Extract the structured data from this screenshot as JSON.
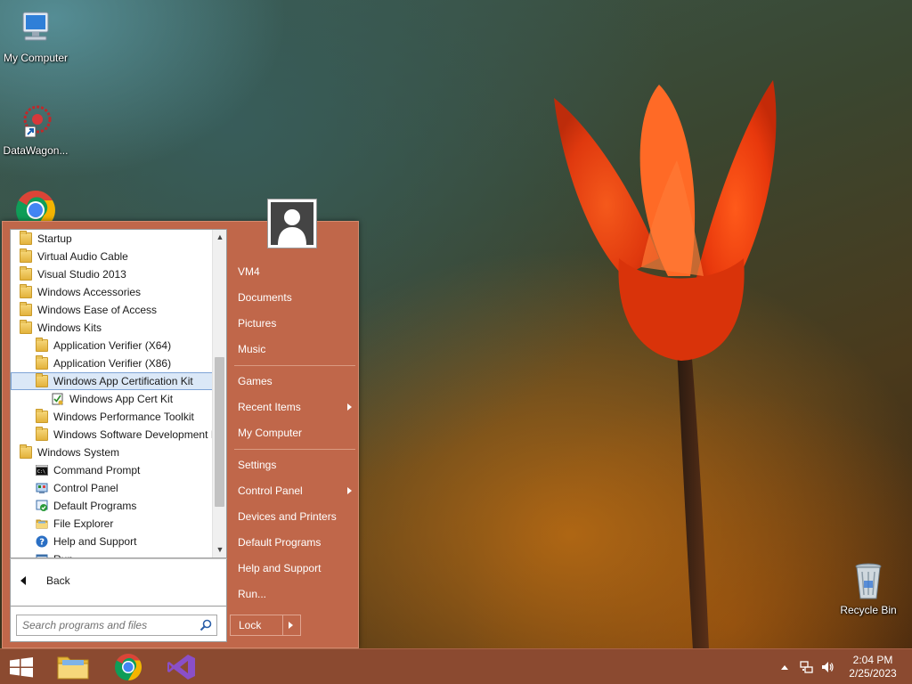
{
  "desktop": {
    "icons": [
      {
        "label": "My Computer"
      },
      {
        "label": "DataWagon..."
      },
      {
        "label": "Recycle Bin"
      }
    ]
  },
  "start_menu": {
    "programs": [
      {
        "label": "Startup",
        "icon": "folder-icon",
        "level": 0
      },
      {
        "label": "Virtual Audio Cable",
        "icon": "folder-icon",
        "level": 0
      },
      {
        "label": "Visual Studio 2013",
        "icon": "folder-icon",
        "level": 0
      },
      {
        "label": "Windows Accessories",
        "icon": "folder-icon",
        "level": 0
      },
      {
        "label": "Windows Ease of Access",
        "icon": "folder-icon",
        "level": 0
      },
      {
        "label": "Windows Kits",
        "icon": "folder-icon",
        "level": 0
      },
      {
        "label": "Application Verifier (X64)",
        "icon": "folder-icon",
        "level": 1
      },
      {
        "label": "Application Verifier (X86)",
        "icon": "folder-icon",
        "level": 1
      },
      {
        "label": "Windows App Certification Kit",
        "icon": "folder-icon",
        "level": 1,
        "selected": true
      },
      {
        "label": "Windows App Cert Kit",
        "icon": "cert-kit-icon",
        "level": 2
      },
      {
        "label": "Windows Performance Toolkit",
        "icon": "folder-icon",
        "level": 1
      },
      {
        "label": "Windows Software Development I",
        "icon": "folder-icon",
        "level": 1
      },
      {
        "label": "Windows System",
        "icon": "folder-icon",
        "level": 0
      },
      {
        "label": "Command Prompt",
        "icon": "command-prompt-icon",
        "level": 1
      },
      {
        "label": "Control Panel",
        "icon": "control-panel-icon",
        "level": 1
      },
      {
        "label": "Default Programs",
        "icon": "default-programs-icon",
        "level": 1
      },
      {
        "label": "File Explorer",
        "icon": "file-explorer-icon",
        "level": 1
      },
      {
        "label": "Help and Support",
        "icon": "help-icon",
        "level": 1
      },
      {
        "label": "Run",
        "icon": "run-icon",
        "level": 1
      }
    ],
    "back_label": "Back",
    "search_placeholder": "Search programs and files",
    "right_items": [
      {
        "label": "VM4",
        "submenu": false
      },
      {
        "label": "Documents",
        "submenu": false
      },
      {
        "label": "Pictures",
        "submenu": false
      },
      {
        "label": "Music",
        "submenu": false
      },
      {
        "label": "Games",
        "submenu": false
      },
      {
        "label": "Recent Items",
        "submenu": true
      },
      {
        "label": "My Computer",
        "submenu": false
      },
      {
        "label": "Settings",
        "submenu": false
      },
      {
        "label": "Control Panel",
        "submenu": true
      },
      {
        "label": "Devices and Printers",
        "submenu": false
      },
      {
        "label": "Default Programs",
        "submenu": false
      },
      {
        "label": "Help and Support",
        "submenu": false
      },
      {
        "label": "Run...",
        "submenu": false
      }
    ],
    "lock_label": "Lock"
  },
  "taskbar": {
    "pinned": [
      "start-button",
      "file-explorer",
      "google-chrome",
      "visual-studio"
    ],
    "clock_time": "2:04 PM",
    "clock_date": "2/25/2023"
  },
  "colors": {
    "accent": "#c0674a",
    "taskbar": "#8b4a30",
    "selection": "#dbe8f7"
  }
}
